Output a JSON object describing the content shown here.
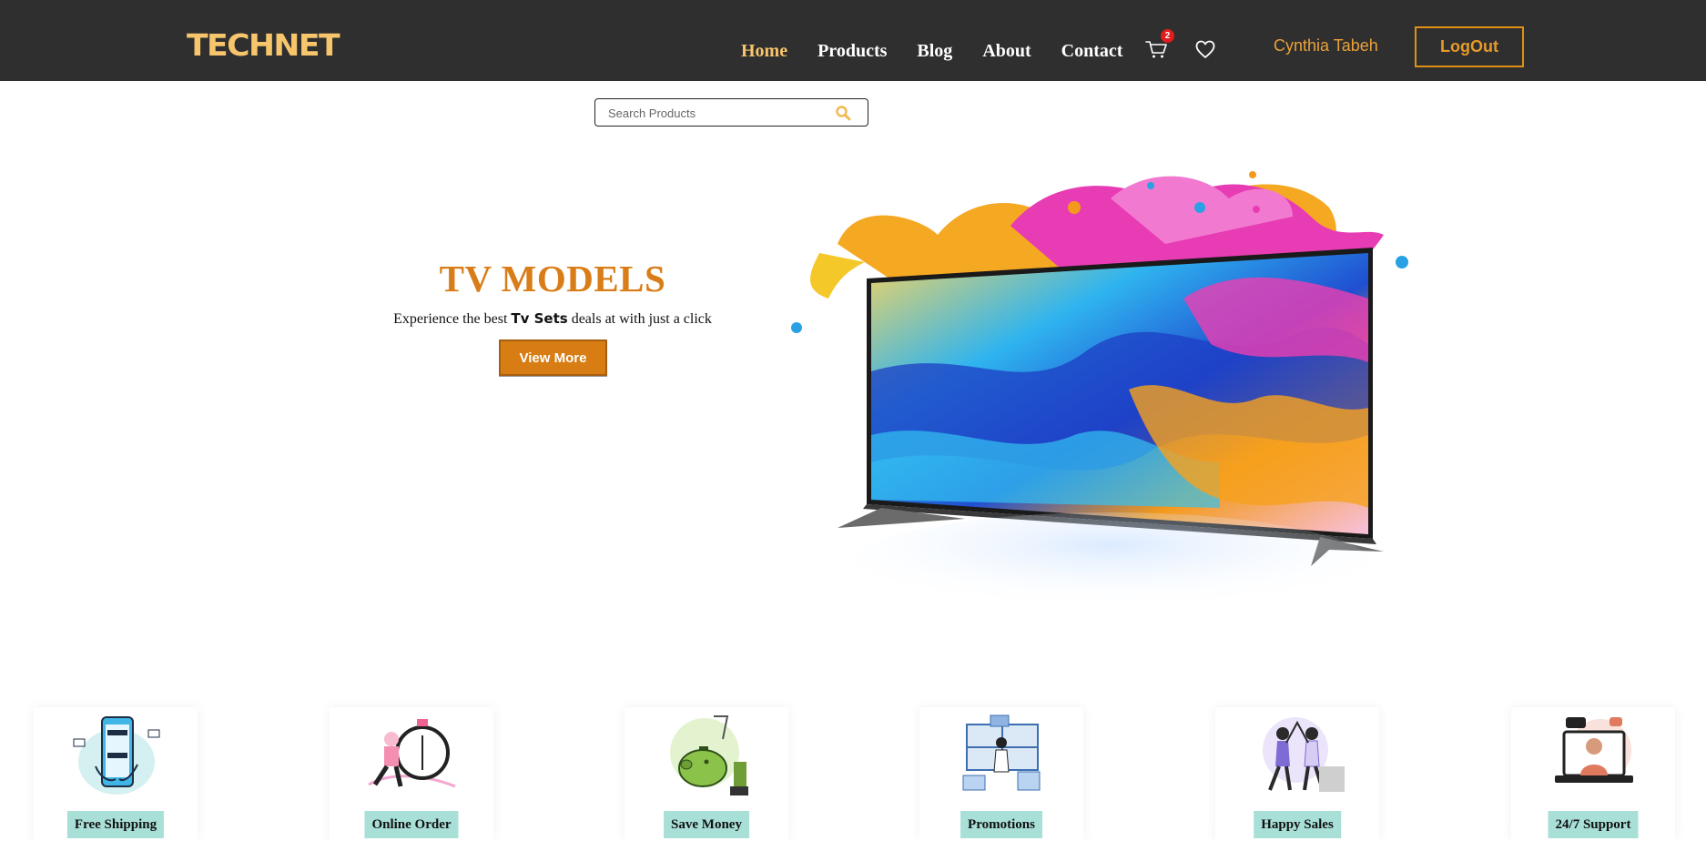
{
  "brand": {
    "logo_text": "TECHNET"
  },
  "nav": {
    "links": [
      {
        "label": "Home",
        "active": true
      },
      {
        "label": "Products",
        "active": false
      },
      {
        "label": "Blog",
        "active": false
      },
      {
        "label": "About",
        "active": false
      },
      {
        "label": "Contact",
        "active": false
      }
    ],
    "cart_count": "2",
    "cart_icon": "cart-icon",
    "wishlist_icon": "heart-icon",
    "user_name": "Cynthia Tabeh",
    "logout_label": "LogOut"
  },
  "search": {
    "placeholder": "Search Products",
    "value": "",
    "icon": "search-icon"
  },
  "hero": {
    "title": "TV MODELS",
    "subtitle_before": "Experience the best ",
    "subtitle_bold": "Tv Sets",
    "subtitle_after": " deals at with just a click",
    "button_label": "View More"
  },
  "features": [
    {
      "label": "Free Shipping",
      "icon": "shipping-illustration-icon"
    },
    {
      "label": "Online Order",
      "icon": "online-order-illustration-icon"
    },
    {
      "label": "Save Money",
      "icon": "piggy-bank-illustration-icon"
    },
    {
      "label": "Promotions",
      "icon": "promotions-illustration-icon"
    },
    {
      "label": "Happy Sales",
      "icon": "happy-sales-illustration-icon"
    },
    {
      "label": "24/7 Support",
      "icon": "support-illustration-icon"
    }
  ],
  "colors": {
    "navbar_bg": "#2f2f2f",
    "accent": "#f7c56b",
    "brand_orange": "#d87d17",
    "badge_red": "#e11d1d",
    "feature_label_bg": "#a8e0d8"
  }
}
